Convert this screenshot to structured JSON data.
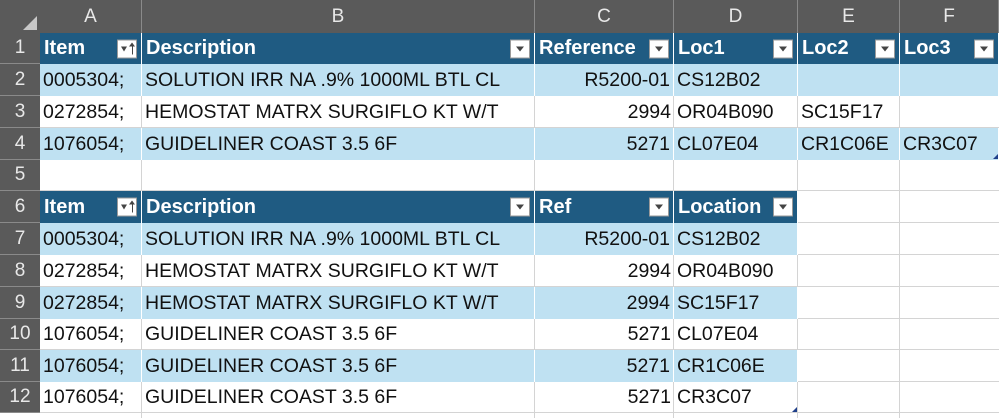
{
  "columns": [
    "A",
    "B",
    "C",
    "D",
    "E",
    "F"
  ],
  "rows": [
    "1",
    "2",
    "3",
    "4",
    "5",
    "6",
    "7",
    "8",
    "9",
    "10",
    "11",
    "12"
  ],
  "table1": {
    "headers": [
      "Item",
      "Description",
      "Reference",
      "Loc1",
      "Loc2",
      "Loc3"
    ],
    "rows": [
      [
        "0005304;",
        "SOLUTION IRR NA .9% 1000ML BTL CL",
        "R5200-01",
        "CS12B02",
        "",
        ""
      ],
      [
        "0272854;",
        "HEMOSTAT MATRX SURGIFLO KT W/T",
        "2994",
        "OR04B090",
        "SC15F17",
        ""
      ],
      [
        "1076054;",
        "GUIDELINER COAST 3.5 6F",
        "5271",
        "CL07E04",
        "CR1C06E",
        "CR3C07"
      ]
    ]
  },
  "table2": {
    "headers": [
      "Item",
      "Description",
      "Ref",
      "Location"
    ],
    "rows": [
      [
        "0005304;",
        "SOLUTION IRR NA .9% 1000ML BTL CL",
        "R5200-01",
        "CS12B02"
      ],
      [
        "0272854;",
        "HEMOSTAT MATRX SURGIFLO KT W/T",
        "2994",
        "OR04B090"
      ],
      [
        "0272854;",
        "HEMOSTAT MATRX SURGIFLO KT W/T",
        "2994",
        "SC15F17"
      ],
      [
        "1076054;",
        "GUIDELINER COAST 3.5 6F",
        "5271",
        "CL07E04"
      ],
      [
        "1076054;",
        "GUIDELINER COAST 3.5 6F",
        "5271",
        "CR1C06E"
      ],
      [
        "1076054;",
        "GUIDELINER COAST 3.5 6F",
        "5271",
        "CR3C07"
      ]
    ]
  },
  "colors": {
    "header_fill": "#1f5b82",
    "band_fill": "#bfe1f2",
    "sheet_header": "#5a5a5a"
  }
}
